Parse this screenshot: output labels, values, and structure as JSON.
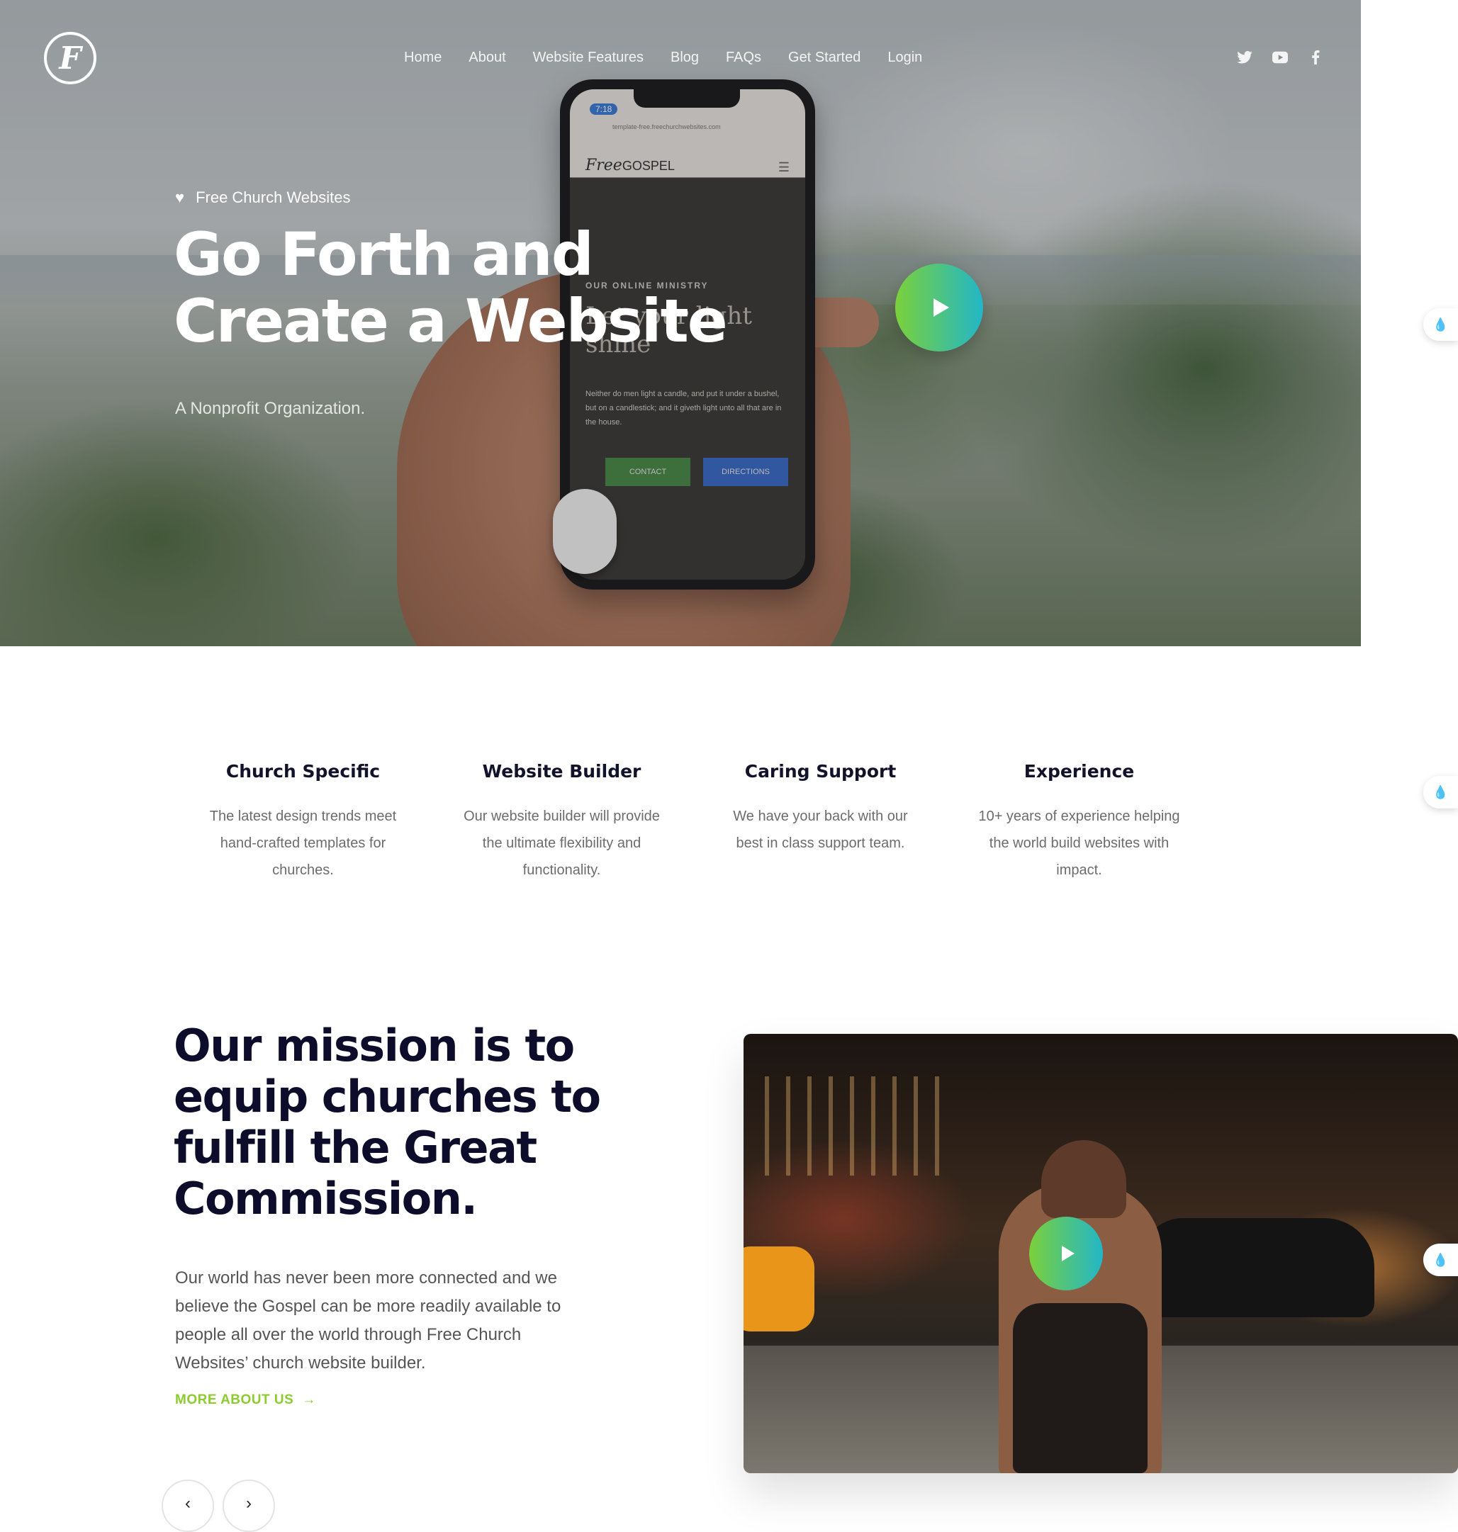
{
  "nav": {
    "logo_glyph": "F",
    "items": [
      "Home",
      "About",
      "Website Features",
      "Blog",
      "FAQs",
      "Get Started",
      "Login"
    ],
    "social": [
      {
        "icon": "twitter-icon",
        "glyph": "🐦"
      },
      {
        "icon": "youtube-icon",
        "glyph": "▶"
      },
      {
        "icon": "facebook-icon",
        "glyph": "f"
      }
    ]
  },
  "hero": {
    "kicker": "Free Church Websites",
    "title_line1": "Go Forth and",
    "title_line2": "Create a Website",
    "subtitle": "A Nonprofit Organization.",
    "phone": {
      "time": "7:18",
      "url": "template-free.freechurchwebsites.com",
      "logo_script": "Free",
      "logo_word": "GOSPEL",
      "kicker": "OUR ONLINE MINISTRY",
      "headline": "Let your light shine",
      "body": "Neither do men light a candle, and put it under a bushel, but on a candlestick; and it giveth light unto all that are in the house.",
      "btn_contact": "CONTACT",
      "btn_directions": "DIRECTIONS"
    }
  },
  "features": [
    {
      "title": "Church Specific",
      "text": "The latest design trends meet hand-crafted templates for churches."
    },
    {
      "title": "Website Builder",
      "text": "Our website builder will provide the ultimate flexibility and functionality."
    },
    {
      "title": "Caring Support",
      "text": "We have your back with our best in class support team."
    },
    {
      "title": "Experience",
      "text": "10+ years of experience helping the world build websites with impact."
    }
  ],
  "mission": {
    "title": "Our mission is to equip churches to fulfill the Great Commission.",
    "body": "Our world has never been more connected and we believe the Gospel can be more readily available to people all over the world through Free Church Websites’ church website builder.",
    "link": "MORE ABOUT US",
    "link_arrow": "→",
    "prev": "‹",
    "next": "›"
  },
  "colors": {
    "accent_green": "#8ccc2e",
    "gradient_start": "#7bd13a",
    "gradient_end": "#22b6c8",
    "heading": "#0d0d2b"
  },
  "widget_icon": "💧"
}
